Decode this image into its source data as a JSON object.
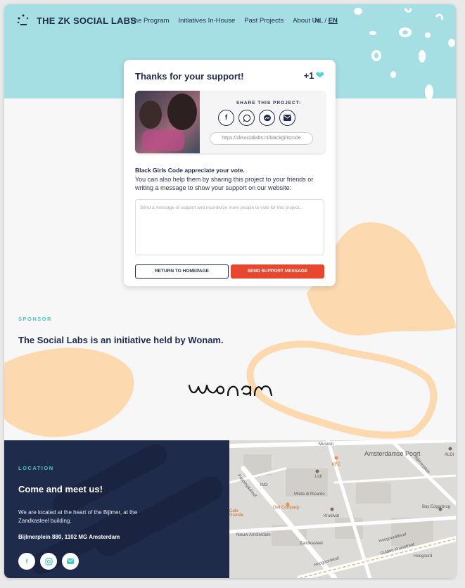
{
  "header": {
    "logo_text": "THE ZK SOCIAL LABS",
    "nav": [
      "The Program",
      "Initiatives In-House",
      "Past Projects",
      "About Us"
    ],
    "lang_nl": "NL /",
    "lang_en": "EN"
  },
  "modal": {
    "title": "Thanks for your support!",
    "counter": "+1",
    "heart_icon": "heart-icon",
    "share_label": "SHARE THIS PROJECT:",
    "share_url": "https://zksociallabs.nl/blackgirlscode",
    "share_icons": [
      "facebook-icon",
      "whatsapp-icon",
      "messenger-icon",
      "email-icon"
    ],
    "appreciate": "Black Girls Code appreciate your vote.",
    "message": "You can also help them by sharing this project to your friends or writing a message to show your support on our website:",
    "textarea_placeholder": "Send a message of support and incentivize more people to vote for this project...",
    "return_label": "RETURN TO HOMEPAGE",
    "send_label": "SEND SUPPORT MESSAGE"
  },
  "sponsor": {
    "eyebrow": "SPONSOR",
    "title": "The Social Labs is an initiative held by Wonam.",
    "logo_name": "wonam-logo"
  },
  "footer": {
    "eyebrow": "LOCATION",
    "title": "Come and meet us!",
    "description": "We are located at the heart of the Bijlmer, at the Zandkasteel building.",
    "address": "Bijlmerplein 880, 1102 MG Amsterdam",
    "socials": [
      "facebook-icon",
      "instagram-icon",
      "email-icon"
    ]
  },
  "map": {
    "labels": [
      "Muskon",
      "Amsterdamse Poort",
      "KFC",
      "Lidl",
      "ING",
      "Moda di Ricardo",
      "Deli Company",
      "Kruidvat",
      "Nieuw Amsterdam",
      "Zandkasteel",
      "Hoogoorddreef",
      "Bijlmerplein",
      "Fopping&dreef",
      "Bay Edgarbrug",
      "Hoogoord",
      "Cafe Grande",
      "ALDI",
      "Gulden Kruisstraat",
      "Hoogoordreef"
    ]
  },
  "colors": {
    "navy": "#1e2b4a",
    "teal": "#a5dfe4",
    "accent_teal": "#49c7c0",
    "peach": "#fdd9b0",
    "red": "#e8472f"
  }
}
